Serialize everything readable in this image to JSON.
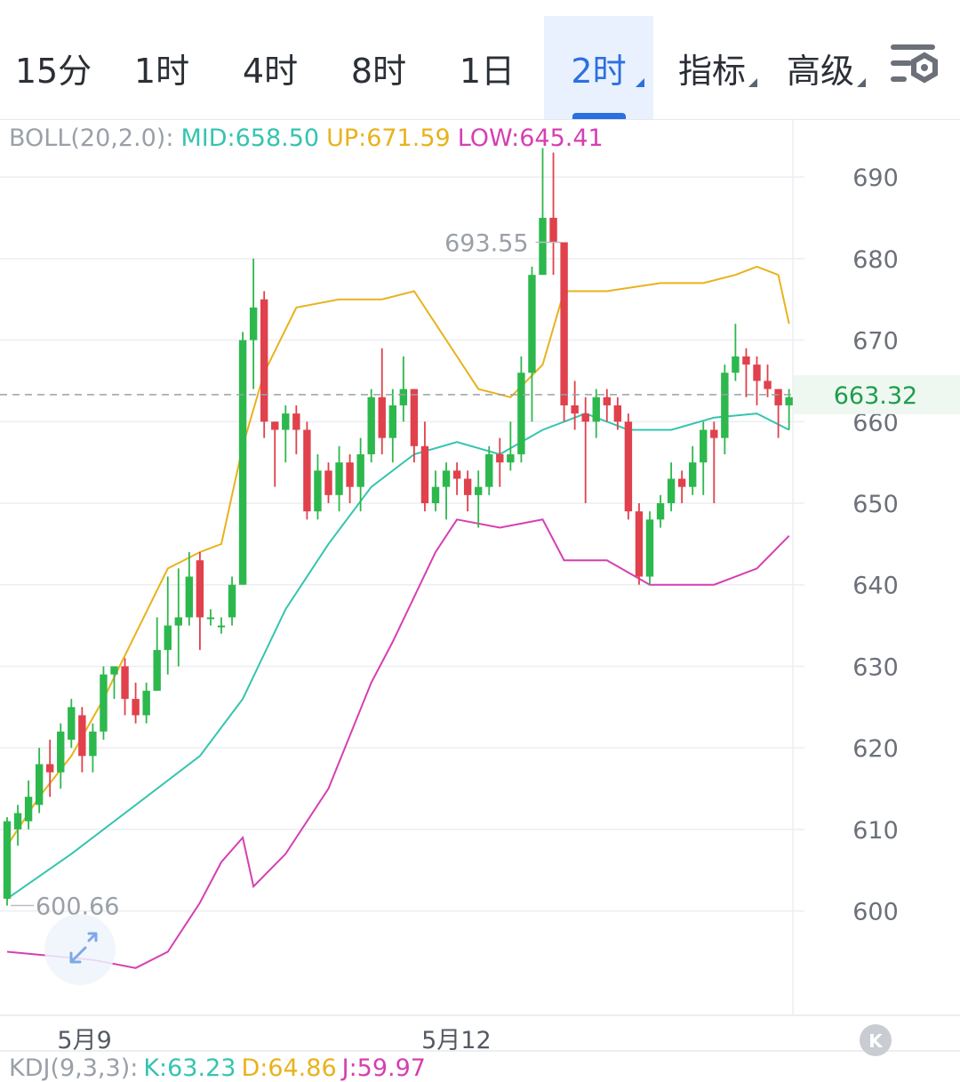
{
  "tabs": [
    {
      "label": "15分",
      "active": false,
      "dropdown": false
    },
    {
      "label": "1时",
      "active": false,
      "dropdown": false
    },
    {
      "label": "4时",
      "active": false,
      "dropdown": false
    },
    {
      "label": "8时",
      "active": false,
      "dropdown": false
    },
    {
      "label": "1日",
      "active": false,
      "dropdown": false
    },
    {
      "label": "2时",
      "active": true,
      "dropdown": true
    },
    {
      "label": "指标",
      "active": false,
      "dropdown": true
    },
    {
      "label": "高级",
      "active": false,
      "dropdown": true
    }
  ],
  "settings_icon": "chart-settings-icon",
  "indicator": {
    "name": "BOLL(20,2.0):",
    "mid_label": "MID:658.50",
    "up_label": "UP:671.59",
    "low_label": "LOW:645.41"
  },
  "kdj": {
    "name": "KDJ(9,3,3):",
    "k_label": "K:63.23",
    "d_label": "D:64.86",
    "j_label": "J:59.97"
  },
  "colors": {
    "up": "#2db84d",
    "down": "#e0414c",
    "mid": "#35c4b0",
    "upper": "#e9b21c",
    "lower": "#d63fb2",
    "grid": "#eceef2",
    "axis_text": "#6b7079",
    "price_tag": "#1f9d4c",
    "active_tab": "#2c6fe0"
  },
  "chart_data": {
    "type": "candlestick",
    "y_ticks": [
      600,
      610,
      620,
      630,
      640,
      650,
      660,
      670,
      680,
      690
    ],
    "ylim": [
      587.2,
      697.1
    ],
    "x_ticks": [
      {
        "index": 8,
        "label": "5月9"
      },
      {
        "index": 42,
        "label": "5月12"
      }
    ],
    "last_price": "663.32",
    "max_label": "693.55",
    "min_label": "600.66",
    "max_index": 52,
    "min_index": 0,
    "candles": [
      [
        601.5,
        611.0,
        611.5,
        600.66
      ],
      [
        610,
        612,
        613,
        608
      ],
      [
        611,
        614,
        616,
        610
      ],
      [
        613,
        618,
        620,
        612
      ],
      [
        618,
        617,
        621,
        614
      ],
      [
        617,
        622,
        623,
        615
      ],
      [
        621,
        625,
        626,
        620
      ],
      [
        624,
        619,
        625,
        617
      ],
      [
        619,
        622,
        623,
        617
      ],
      [
        622,
        629,
        630,
        621
      ],
      [
        629,
        630,
        630,
        626
      ],
      [
        630,
        626,
        631,
        624
      ],
      [
        626,
        624,
        628,
        623
      ],
      [
        624,
        627,
        628,
        623
      ],
      [
        627,
        632,
        636,
        627
      ],
      [
        632,
        635,
        641,
        629
      ],
      [
        635,
        636,
        642,
        630
      ],
      [
        636,
        641,
        644,
        635
      ],
      [
        643,
        636,
        644,
        632
      ],
      [
        636,
        636,
        637,
        635
      ],
      [
        635,
        635,
        636,
        634
      ],
      [
        636,
        640,
        641,
        635
      ],
      [
        640,
        670,
        671,
        640
      ],
      [
        670,
        674,
        680,
        664
      ],
      [
        675,
        660,
        676,
        658
      ],
      [
        660,
        659,
        660,
        652
      ],
      [
        659,
        661,
        662,
        655
      ],
      [
        661,
        659,
        662,
        656
      ],
      [
        659,
        649,
        660,
        648
      ],
      [
        649,
        654,
        656,
        648
      ],
      [
        654,
        651,
        655,
        650
      ],
      [
        651,
        655,
        657,
        649
      ],
      [
        655,
        652,
        656,
        650
      ],
      [
        652,
        656,
        658,
        649
      ],
      [
        656,
        663,
        664,
        655
      ],
      [
        663,
        658,
        669,
        656
      ],
      [
        658,
        662,
        664,
        655
      ],
      [
        662,
        664,
        668,
        660
      ],
      [
        664,
        657,
        664,
        655
      ],
      [
        657,
        650,
        660,
        649
      ],
      [
        650,
        652,
        654,
        649
      ],
      [
        652,
        654,
        655,
        648
      ],
      [
        654,
        653,
        655,
        651
      ],
      [
        653,
        651,
        654,
        649
      ],
      [
        651,
        652,
        654,
        647
      ],
      [
        652,
        656,
        657,
        651
      ],
      [
        656,
        655,
        658,
        652
      ],
      [
        655,
        656,
        660,
        654
      ],
      [
        656,
        666,
        668,
        655
      ],
      [
        666,
        678,
        679,
        660
      ],
      [
        678,
        685,
        693.55,
        678
      ],
      [
        685,
        682,
        693,
        678
      ],
      [
        682,
        662,
        682,
        660
      ],
      [
        662,
        661,
        665,
        659
      ],
      [
        661,
        660,
        663,
        650
      ],
      [
        660,
        663,
        664,
        658
      ],
      [
        663,
        662,
        664,
        660
      ],
      [
        662,
        660,
        663,
        659
      ],
      [
        660,
        649,
        661,
        648
      ],
      [
        649,
        641,
        650,
        640
      ],
      [
        641,
        648,
        649,
        640
      ],
      [
        648,
        650,
        651,
        647
      ],
      [
        650,
        653,
        655,
        649
      ],
      [
        653,
        652,
        654,
        650
      ],
      [
        652,
        655,
        657,
        651
      ],
      [
        655,
        659,
        660,
        651
      ],
      [
        659,
        658,
        660,
        650
      ],
      [
        658,
        666,
        667,
        656
      ],
      [
        666,
        668,
        672,
        665
      ],
      [
        668,
        667,
        669,
        663
      ],
      [
        667,
        665,
        668,
        662
      ],
      [
        665,
        664,
        667,
        663
      ],
      [
        664,
        662,
        664,
        658
      ],
      [
        662,
        663,
        664,
        659
      ]
    ],
    "mid": [
      [
        0,
        601.5
      ],
      [
        6,
        607
      ],
      [
        12,
        613
      ],
      [
        18,
        619
      ],
      [
        22,
        626
      ],
      [
        26,
        637
      ],
      [
        30,
        645
      ],
      [
        34,
        652
      ],
      [
        38,
        656
      ],
      [
        42,
        657.5
      ],
      [
        46,
        656
      ],
      [
        50,
        659
      ],
      [
        54,
        661
      ],
      [
        58,
        659
      ],
      [
        62,
        659
      ],
      [
        66,
        660.5
      ],
      [
        70,
        661
      ],
      [
        73,
        659
      ]
    ],
    "upper": [
      [
        0,
        608
      ],
      [
        3,
        614
      ],
      [
        6,
        619
      ],
      [
        9,
        626
      ],
      [
        12,
        634
      ],
      [
        15,
        642
      ],
      [
        18,
        644
      ],
      [
        20,
        645
      ],
      [
        22,
        657
      ],
      [
        24,
        666
      ],
      [
        27,
        674
      ],
      [
        31,
        675
      ],
      [
        35,
        675
      ],
      [
        38,
        676
      ],
      [
        41,
        670
      ],
      [
        44,
        664
      ],
      [
        47,
        663
      ],
      [
        50,
        667
      ],
      [
        52,
        676
      ],
      [
        56,
        676
      ],
      [
        61,
        677
      ],
      [
        65,
        677
      ],
      [
        68,
        678
      ],
      [
        70,
        679
      ],
      [
        72,
        678
      ],
      [
        73,
        672
      ]
    ],
    "lower": [
      [
        0,
        595
      ],
      [
        4,
        594.5
      ],
      [
        8,
        594
      ],
      [
        12,
        593
      ],
      [
        15,
        595
      ],
      [
        18,
        601
      ],
      [
        20,
        606
      ],
      [
        22,
        609
      ],
      [
        23,
        603
      ],
      [
        26,
        607
      ],
      [
        30,
        615
      ],
      [
        34,
        628
      ],
      [
        36,
        633
      ],
      [
        40,
        644
      ],
      [
        42,
        648
      ],
      [
        46,
        647
      ],
      [
        50,
        648
      ],
      [
        52,
        643
      ],
      [
        56,
        643
      ],
      [
        60,
        640
      ],
      [
        66,
        640
      ],
      [
        70,
        642
      ],
      [
        73,
        646
      ]
    ]
  }
}
